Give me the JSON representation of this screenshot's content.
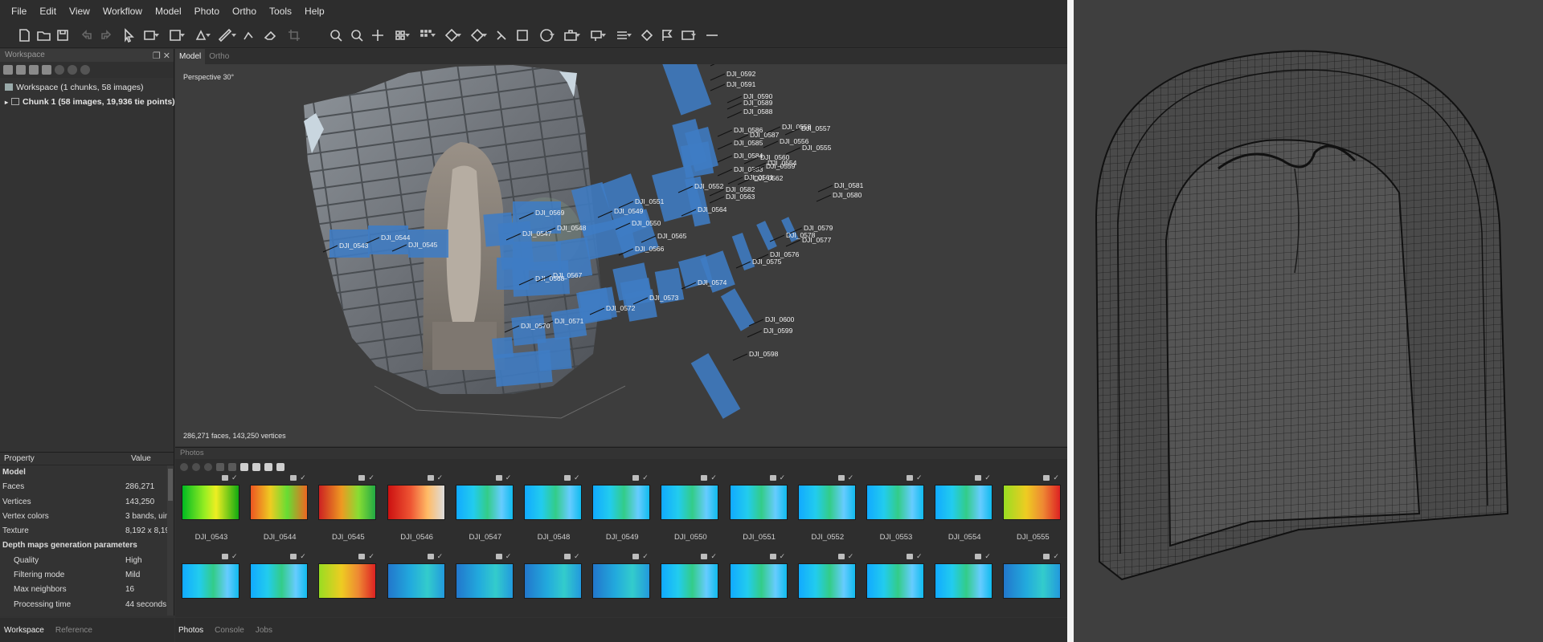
{
  "menu": [
    "File",
    "Edit",
    "View",
    "Workflow",
    "Model",
    "Photo",
    "Ortho",
    "Tools",
    "Help"
  ],
  "workspace": {
    "panel_title": "Workspace",
    "root": "Workspace (1 chunks, 58 images)",
    "chunk": "Chunk 1 (58 images, 19,936 tie points) [R]"
  },
  "properties": {
    "header_property": "Property",
    "header_value": "Value",
    "rows": [
      {
        "k": "Model",
        "v": "",
        "type": "grp"
      },
      {
        "k": "Faces",
        "v": "286,271",
        "type": "row"
      },
      {
        "k": "Vertices",
        "v": "143,250",
        "type": "row"
      },
      {
        "k": "Vertex colors",
        "v": "3 bands, uin",
        "type": "row"
      },
      {
        "k": "Texture",
        "v": "8,192 x 8,19:",
        "type": "row"
      },
      {
        "k": "Depth maps generation parameters",
        "v": "",
        "type": "grp"
      },
      {
        "k": "Quality",
        "v": "High",
        "type": "sub"
      },
      {
        "k": "Filtering mode",
        "v": "Mild",
        "type": "sub"
      },
      {
        "k": "Max neighbors",
        "v": "16",
        "type": "sub"
      },
      {
        "k": "Processing time",
        "v": "44 seconds",
        "type": "sub"
      }
    ]
  },
  "bottom_tabs_left": [
    "Workspace",
    "Reference"
  ],
  "bottom_tabs_right": [
    "Photos",
    "Console",
    "Jobs"
  ],
  "viewport": {
    "tabs": [
      "Model",
      "Ortho"
    ],
    "projection": "Perspective 30°",
    "stats": "286,271 faces, 143,250 vertices"
  },
  "cameras": [
    {
      "label": "DJI_0593"
    },
    {
      "label": "DJI_0592"
    },
    {
      "label": "DJI_0591"
    },
    {
      "label": "DJI_0590"
    },
    {
      "label": "DJI_0589"
    },
    {
      "label": "DJI_0588"
    },
    {
      "label": "DJI_0586"
    },
    {
      "label": "DJI_0587"
    },
    {
      "label": "DJI_0585"
    },
    {
      "label": "DJI_0584"
    },
    {
      "label": "DJI_0583"
    },
    {
      "label": "DJI_0582"
    },
    {
      "label": "DJI_0581"
    },
    {
      "label": "DJI_0580"
    },
    {
      "label": "DJI_0579"
    },
    {
      "label": "DJI_0578"
    },
    {
      "label": "DJI_0577"
    },
    {
      "label": "DJI_0576"
    },
    {
      "label": "DJI_0575"
    },
    {
      "label": "DJI_0574"
    },
    {
      "label": "DJI_0573"
    },
    {
      "label": "DJI_0572"
    },
    {
      "label": "DJI_0571"
    },
    {
      "label": "DJI_0570"
    },
    {
      "label": "DJI_0569"
    },
    {
      "label": "DJI_0568"
    },
    {
      "label": "DJI_0567"
    },
    {
      "label": "DJI_0566"
    },
    {
      "label": "DJI_0565"
    },
    {
      "label": "DJI_0564"
    },
    {
      "label": "DJI_0563"
    },
    {
      "label": "DJI_0562"
    },
    {
      "label": "DJI_0561"
    },
    {
      "label": "DJI_0560"
    },
    {
      "label": "DJI_0559"
    },
    {
      "label": "DJI_0558"
    },
    {
      "label": "DJI_0557"
    },
    {
      "label": "DJI_0556"
    },
    {
      "label": "DJI_0555"
    },
    {
      "label": "DJI_0554"
    },
    {
      "label": "DJI_0553"
    },
    {
      "label": "DJI_0552"
    },
    {
      "label": "DJI_0551"
    },
    {
      "label": "DJI_0550"
    },
    {
      "label": "DJI_0549"
    },
    {
      "label": "DJI_0548"
    },
    {
      "label": "DJI_0547"
    },
    {
      "label": "DJI_0546"
    },
    {
      "label": "DJI_0545"
    },
    {
      "label": "DJI_0544"
    },
    {
      "label": "DJI_0543"
    },
    {
      "label": "DJI_0600"
    },
    {
      "label": "DJI_0599"
    },
    {
      "label": "DJI_0598"
    }
  ],
  "photos": {
    "title": "Photos",
    "row1": [
      "DJI_0543",
      "DJI_0544",
      "DJI_0545",
      "DJI_0546",
      "DJI_0547",
      "DJI_0548",
      "DJI_0549",
      "DJI_0550",
      "DJI_0551",
      "DJI_0552",
      "DJI_0553",
      "DJI_0554",
      "DJI_0555"
    ],
    "row1_styles": [
      "gr",
      "yo",
      "rg",
      "rd",
      "bl",
      "bl",
      "bl",
      "bl",
      "bl",
      "bl",
      "bl",
      "bl",
      "yr"
    ],
    "row2_styles": [
      "bl",
      "bl",
      "yr",
      "db",
      "db",
      "db",
      "db",
      "bl",
      "bl",
      "bl",
      "bl",
      "bl",
      "db"
    ]
  },
  "colors": {
    "camera_blue": "#3f7cc4",
    "panel_bg": "#323232",
    "viewport_bg": "#3d3d3d"
  }
}
